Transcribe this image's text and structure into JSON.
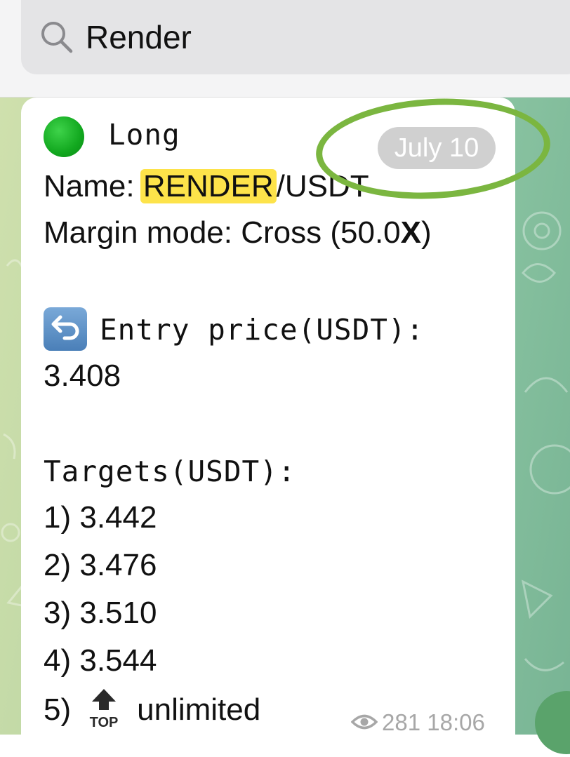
{
  "search": {
    "value": "Render"
  },
  "message": {
    "direction_emoji": "green-circle",
    "direction": "Long",
    "name_label": "Name: ",
    "name_highlight": "RENDER",
    "name_rest": "/USDT",
    "margin_label": "Margin mode: Cross (50.0",
    "margin_bold": "X",
    "margin_close": ")",
    "entry_label": "Entry price(USDT):",
    "entry_value": "3.408",
    "targets_label": "Targets(USDT):",
    "targets": [
      "1) 3.442",
      "2) 3.476",
      "3) 3.510",
      "4) 3.544"
    ],
    "target5_prefix": "5)",
    "target5_suffix": "unlimited",
    "views": "281",
    "time": "18:06"
  },
  "date_pill": "July 10",
  "colors": {
    "highlight": "#fde34a",
    "annotation_ring": "#7bb640",
    "date_pill": "#d0d0d0"
  }
}
